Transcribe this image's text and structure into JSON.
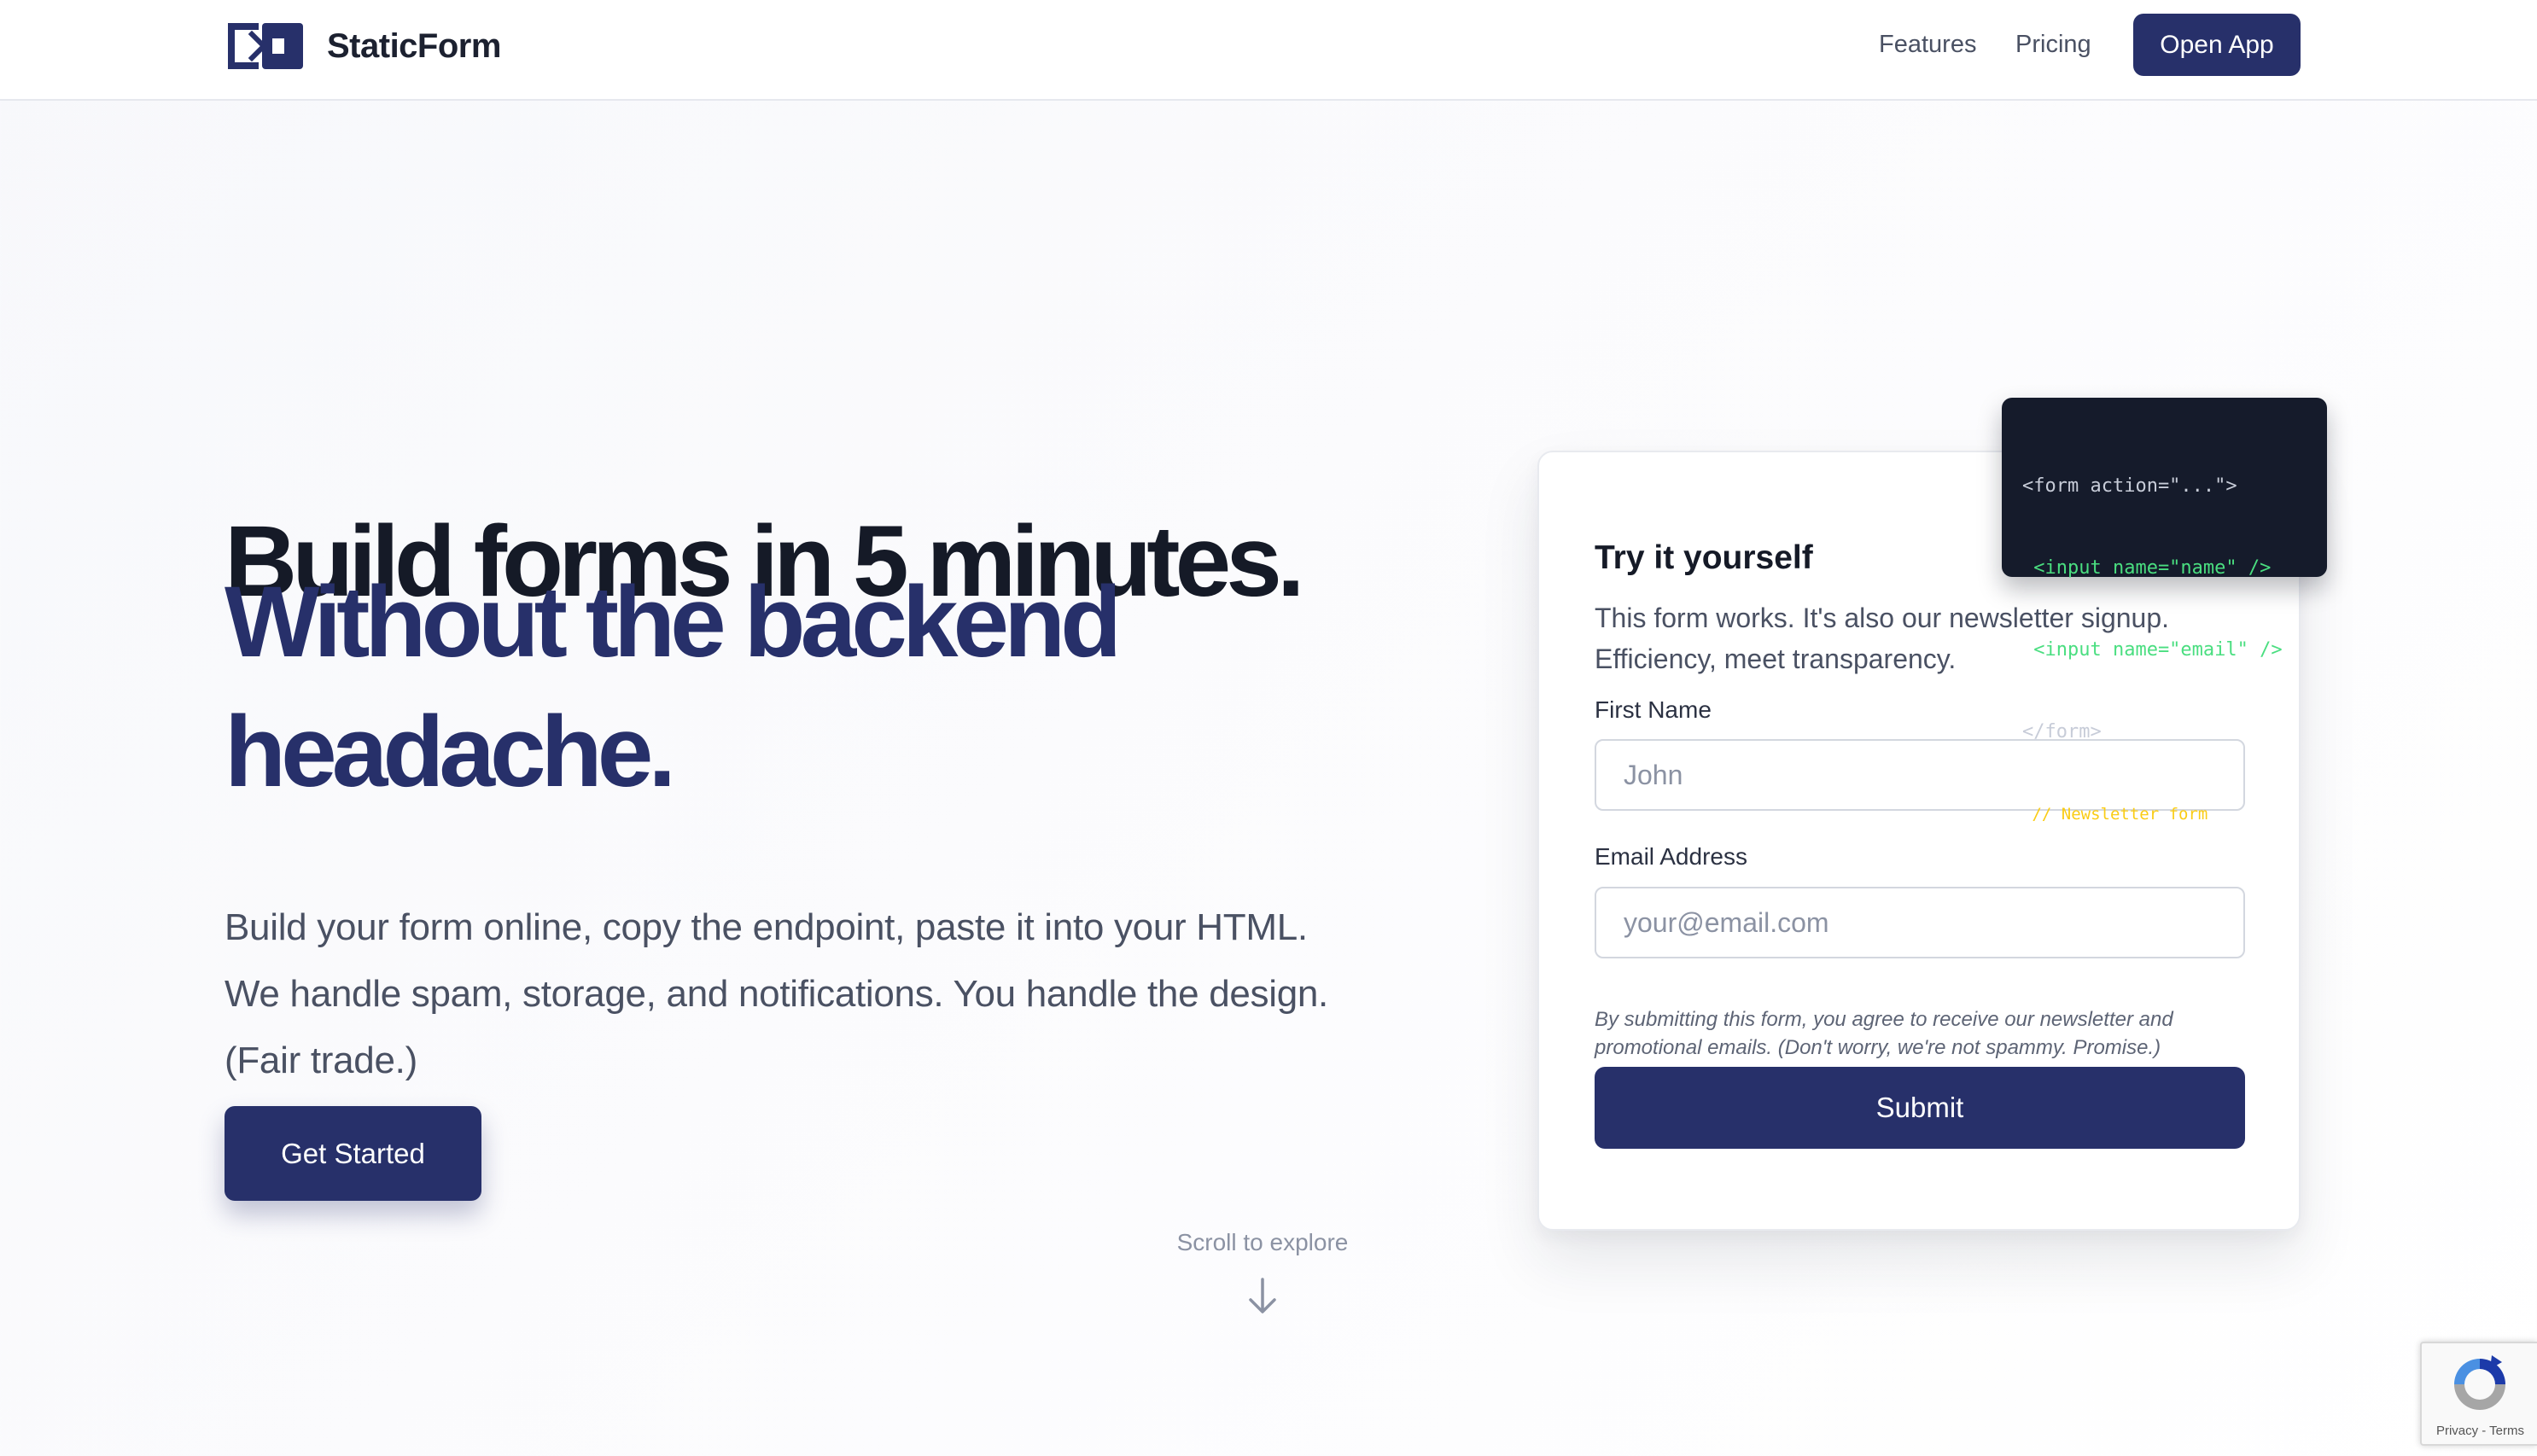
{
  "nav": {
    "brand": "StaticForm",
    "links": [
      "Features",
      "Pricing"
    ],
    "cta": "Open App"
  },
  "hero": {
    "headline_1": "Build forms in 5 minutes.",
    "headline_2": "Without the backend",
    "headline_3": "headache.",
    "lead": "Build your form online, copy the endpoint, paste it into your HTML. We handle spam, storage, and notifications. You handle the design. (Fair trade.)",
    "cta": "Get Started",
    "scroll_hint": "Scroll to explore"
  },
  "form_card": {
    "title": "Try it yourself",
    "description": "This form works. It's also our newsletter signup. Efficiency, meet transparency.",
    "first_name_label": "First Name",
    "first_name_placeholder": "John",
    "email_label": "Email Address",
    "email_placeholder": "your@email.com",
    "disclaimer": "By submitting this form, you agree to receive our newsletter and promotional emails. (Don't worry, we're not spammy. Promise.)",
    "submit": "Submit"
  },
  "code_snippet": {
    "lines": [
      "<form action=\"...\">",
      " <input name=\"name\" />",
      " <input name=\"email\" />",
      "</form>",
      " // Newsletter form"
    ]
  },
  "recaptcha": {
    "links": "Privacy - Terms"
  },
  "colors": {
    "brand_navy": "#27306a",
    "heading_dark": "#151a27",
    "code_bg": "#151b2b",
    "code_green": "#4ade80",
    "code_comment": "#facc15"
  },
  "icons": {
    "logo": "bracket-arrow-logo-icon",
    "scroll": "arrow-down-icon",
    "recaptcha": "recaptcha-icon"
  }
}
